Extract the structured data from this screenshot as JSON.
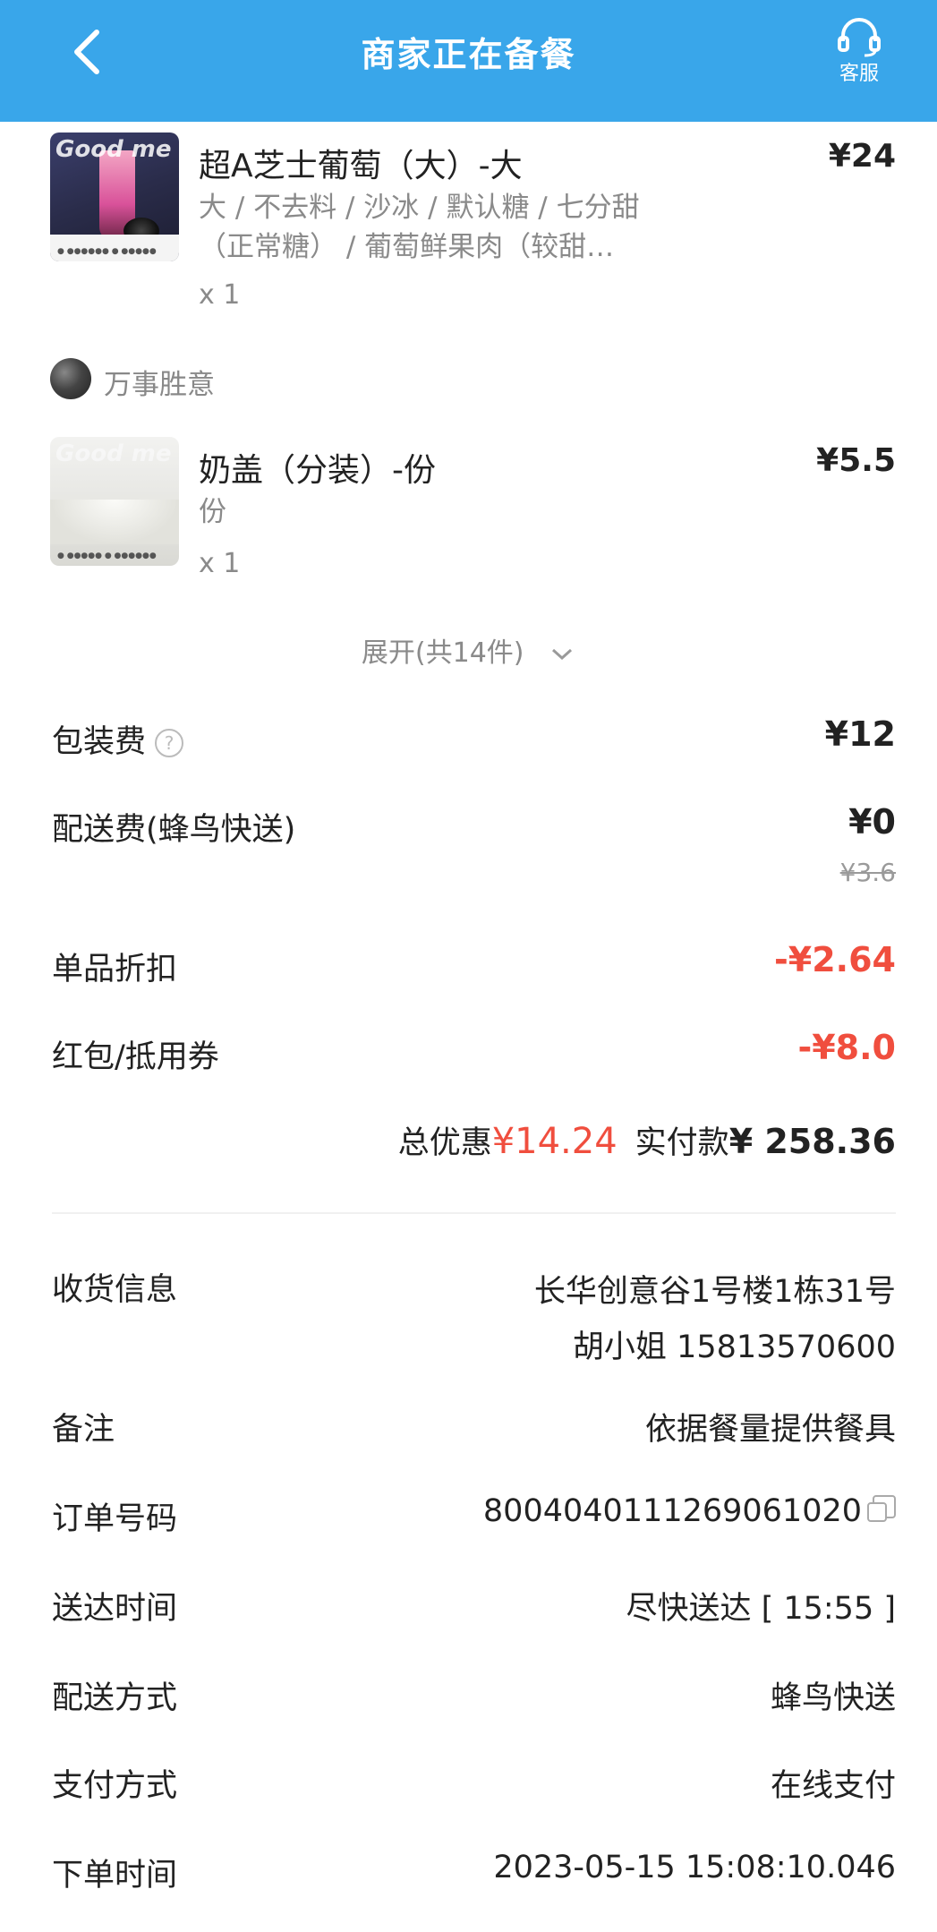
{
  "header": {
    "title": "商家正在备餐",
    "service_label": "客服",
    "color": "#39a6ea"
  },
  "items": [
    {
      "name": "超A芝士葡萄（大）-大",
      "price": "¥24",
      "desc": "大 / 不去料 / 沙冰 / 默认糖 / 七分甜（正常糖） / 葡萄鲜果肉（较甜…",
      "qty": "x 1",
      "thumb_text": "Good me"
    },
    {
      "name": "奶盖（分装）-份",
      "price": "¥5.5",
      "desc": "份",
      "qty": "x 1",
      "thumb_text": "Good me"
    }
  ],
  "shop": {
    "name": "万事胜意"
  },
  "expand_label": "展开(共14件)",
  "fees": {
    "packaging": {
      "label": "包装费",
      "value": "¥12"
    },
    "delivery": {
      "label": "配送费(蜂鸟快送)",
      "value": "¥0",
      "original": "¥3.6"
    },
    "item_discount": {
      "label": "单品折扣",
      "value": "-¥2.64"
    },
    "coupon": {
      "label": "红包/抵用券",
      "value": "-¥8.0"
    }
  },
  "totals": {
    "discount_label": "总优惠",
    "discount_value": "¥14.24",
    "paid_label": "实付款",
    "paid_value": "¥ 258.36"
  },
  "info": {
    "address": {
      "label": "收货信息",
      "line1": "长华创意谷1号楼1栋31号",
      "line2": "胡小姐 15813570600"
    },
    "remark": {
      "label": "备注",
      "value": "依据餐量提供餐具"
    },
    "order_no": {
      "label": "订单号码",
      "value": "8004040111269061020"
    },
    "delivery_time": {
      "label": "送达时间",
      "value": "尽快送达 [ 15:55 ]"
    },
    "delivery_method": {
      "label": "配送方式",
      "value": "蜂鸟快送"
    },
    "payment": {
      "label": "支付方式",
      "value": "在线支付"
    },
    "order_time": {
      "label": "下单时间",
      "value": "2023-05-15 15:08:10.046"
    }
  },
  "colors": {
    "accent": "#39a6ea",
    "discount": "#f04e3e"
  }
}
